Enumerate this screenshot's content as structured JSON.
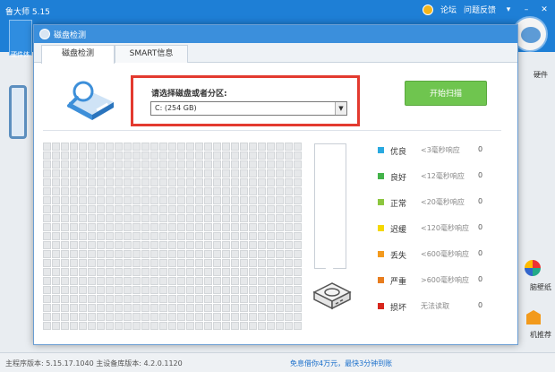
{
  "app": {
    "title": "鲁大师 5.15",
    "forum": "论坛",
    "feedback": "问题反馈",
    "left_tab_label": "硬件体",
    "right_label_hw": "硬件",
    "right_label_wall": "脑壁纸",
    "right_label_rec": "机推荐"
  },
  "status": {
    "version": "主程序版本: 5.15.17.1040    主设备库版本: 4.2.0.1120",
    "promo": "免息借你4万元，最快3分钟到账"
  },
  "dialog": {
    "title": "磁盘检测",
    "tabs": [
      {
        "label": "磁盘检测"
      },
      {
        "label": "SMART信息"
      }
    ],
    "select_label": "请选择磁盘或者分区:",
    "selected_disk": "C:  (254 GB)",
    "scan_button": "开始扫描"
  },
  "legend": [
    {
      "name": "优良",
      "desc": "<3毫秒响应",
      "count": "0",
      "color": "#29a9e0"
    },
    {
      "name": "良好",
      "desc": "<12毫秒响应",
      "count": "0",
      "color": "#43b34a"
    },
    {
      "name": "正常",
      "desc": "<20毫秒响应",
      "count": "0",
      "color": "#8cc63f"
    },
    {
      "name": "迟缓",
      "desc": "<120毫秒响应",
      "count": "0",
      "color": "#f5d800"
    },
    {
      "name": "丢失",
      "desc": "<600毫秒响应",
      "count": "0",
      "color": "#f39a1e"
    },
    {
      "name": "严重",
      "desc": ">600毫秒响应",
      "count": "0",
      "color": "#e87d1e"
    },
    {
      "name": "损坏",
      "desc": "无法读取",
      "count": "0",
      "color": "#d7261c"
    }
  ],
  "colors": {
    "accent": "#3b8fdc",
    "highlight_border": "#e33a2f",
    "scan_button": "#6fc54f"
  }
}
